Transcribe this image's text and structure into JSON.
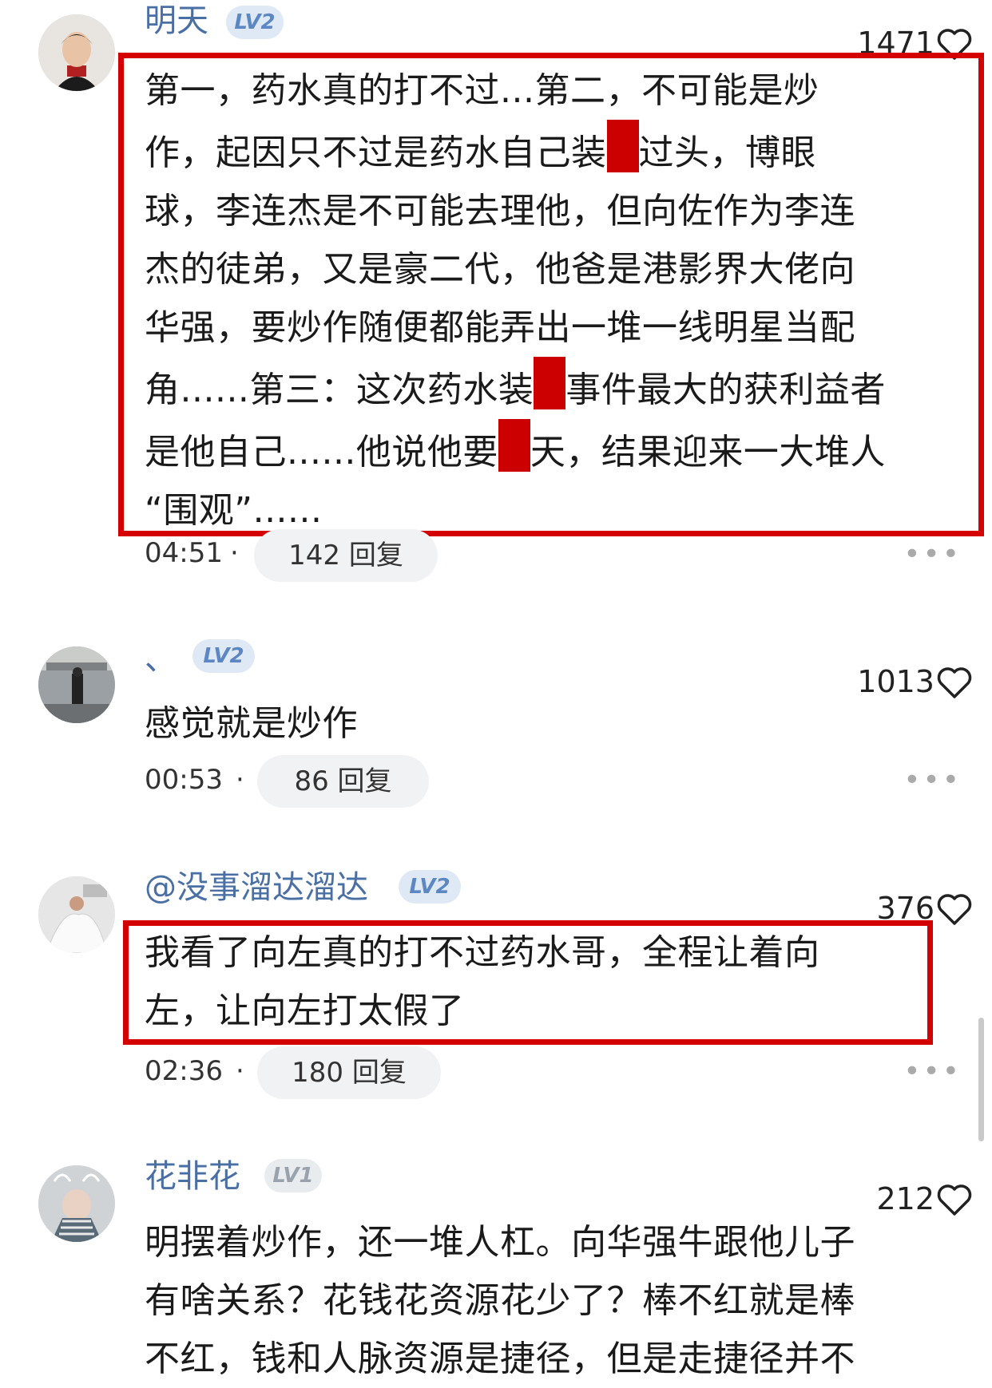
{
  "comments": [
    {
      "username": "明天",
      "level": "LV2",
      "likes": "1471",
      "lines": [
        [
          "第一，药水真的打不过...第二，不可能是炒"
        ],
        [
          "作，起因只不过是药水自己装",
          "█",
          "过头，博眼"
        ],
        [
          "球，李连杰是不可能去理他，但向佐作为李连"
        ],
        [
          "杰的徒弟，又是豪二代，他爸是港影界大佬向"
        ],
        [
          "华强，要炒作随便都能弄出一堆一线明星当配"
        ],
        [
          "角......第三：这次药水装",
          "█",
          "事件最大的获利益者"
        ],
        [
          "是他自己......他说他要",
          "█",
          "天，结果迎来一大堆人"
        ],
        [
          "“围观”......"
        ]
      ],
      "time": "04:51",
      "replies": "142 回复"
    },
    {
      "username": "、",
      "level": "LV2",
      "likes": "1013",
      "text": "感觉就是炒作",
      "time": "00:53",
      "replies": "86 回复"
    },
    {
      "username": "@没事溜达溜达",
      "level": "LV2",
      "likes": "376",
      "lines": [
        "我看了向左真的打不过药水哥，全程让着向",
        "左，让向左打太假了"
      ],
      "time": "02:36",
      "replies": "180 回复"
    },
    {
      "username": "花非花",
      "level": "LV1",
      "likes": "212",
      "lines": [
        "明摆着炒作，还一堆人杠。向华强牛跟他儿子",
        "有啥关系？花钱花资源花少了？棒不红就是棒",
        "不红，钱和人脉资源是捷径，但是走捷径并不"
      ]
    }
  ],
  "more_label": "•••",
  "colors": {
    "username": "#4a6fa5",
    "highlight_box": "#d40000",
    "redaction": "#cc0000"
  }
}
